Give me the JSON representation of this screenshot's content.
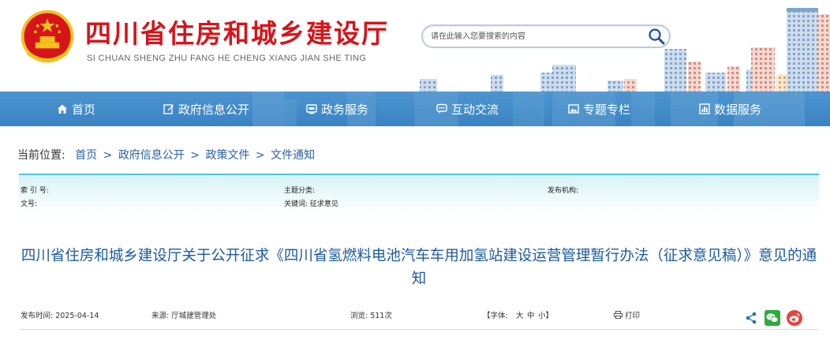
{
  "header": {
    "title": "四川省住房和城乡建设厅",
    "pinyin": "SI CHUAN SHENG ZHU FANG HE CHENG XIANG JIAN SHE TING",
    "search_placeholder": "请在此输入您要搜索的内容",
    "accent_color": "#d7141a"
  },
  "nav": {
    "items": [
      {
        "label": "首页",
        "icon": "home-icon"
      },
      {
        "label": "政府信息公开",
        "icon": "edit-icon"
      },
      {
        "label": "政务服务",
        "icon": "service-icon"
      },
      {
        "label": "互动交流",
        "icon": "chat-icon"
      },
      {
        "label": "专题专栏",
        "icon": "picture-icon"
      },
      {
        "label": "数据服务",
        "icon": "data-icon"
      }
    ],
    "bg_color": "#4290cc"
  },
  "breadcrumb": {
    "prefix": "当前位置:",
    "items": [
      "首页",
      "政府信息公开",
      "政策文件",
      "文件通知"
    ],
    "separator": ">"
  },
  "meta": {
    "index_no": "索 引 号:",
    "topic": "主题分类:",
    "publisher": "发布机构:",
    "doc_no": "文号:",
    "keywords": "关键词:  征求意见"
  },
  "article": {
    "title": "四川省住房和城乡建设厅关于公开征求《四川省氢燃料电池汽车车用加氢站建设运营管理暂行办法（征求意见稿）》意见的通知",
    "publish_time": "发布时间:  2025-04-14",
    "source": "来源:  厅城建管理处",
    "views": "浏览:  511次",
    "font_label": "【字体:",
    "font_large": "大",
    "font_medium": "中",
    "font_small": "小】",
    "print": "打印",
    "share_icons": [
      "share-icon",
      "wechat-icon",
      "weibo-icon"
    ]
  }
}
